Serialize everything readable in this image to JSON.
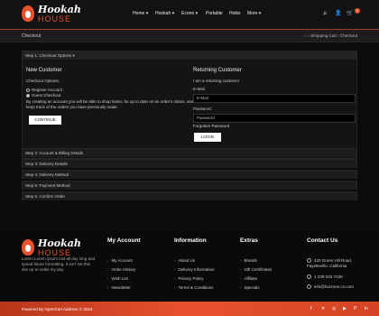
{
  "brand": {
    "line1": "Hookah",
    "line2": "HOUSE"
  },
  "nav": [
    {
      "label": "Home ▾"
    },
    {
      "label": "Hookah ▾"
    },
    {
      "label": "Econo ▾"
    },
    {
      "label": "Portable"
    },
    {
      "label": "Hoiks"
    },
    {
      "label": "More ▾"
    }
  ],
  "header_icons": {
    "search": "⌕",
    "user": "👤",
    "cart": "🛒",
    "cart_count": "0"
  },
  "breadcrumb": {
    "title": "Checkout",
    "home": "⌂",
    "trail": "› Shopping Cart › Checkout"
  },
  "steps": {
    "step1": "Step 1: Checkout Options ▾",
    "step2": "Step 2: Account & Billing Details",
    "step3": "Step 3: Delivery Details",
    "step4": "Step 4: Delivery Method",
    "step5": "Step 5: Payment Method",
    "step6": "Step 6: Confirm Order"
  },
  "new_customer": {
    "heading": "New Customer",
    "options_label": "Checkout Options:",
    "register": "Register Account",
    "guest": "Guest Checkout",
    "info": "By creating an account you will be able to shop faster, be up to date on an order's status, and keep track of the orders you have previously made.",
    "continue": "CONTINUE"
  },
  "returning_customer": {
    "heading": "Returning Customer",
    "sub": "I am a returning customer",
    "email_label": "E-Mail",
    "email_placeholder": "E-Mail",
    "password_label": "Password",
    "password_placeholder": "Password",
    "forgot": "Forgotten Password",
    "login": "LOGIN"
  },
  "footer": {
    "about": "Lorem Lorem ipsum lost all day long and speed future formatting. It isn't set this site up to make my day.",
    "my_account": {
      "heading": "My Account",
      "items": [
        "My Account",
        "Order History",
        "Wish List",
        "Newsletter"
      ]
    },
    "information": {
      "heading": "Information",
      "items": [
        "About Us",
        "Delivery Information",
        "Privacy Policy",
        "Terms & Conditions"
      ]
    },
    "extras": {
      "heading": "Extras",
      "items": [
        "Brands",
        "Gift Certificates",
        "Affiliate",
        "Specials"
      ]
    },
    "contact": {
      "heading": "Contact Us",
      "address": "420 Green Hill Road, Fayetteville, California",
      "phone": "1 239-233-7438",
      "email": "info@hurzone.co.com"
    },
    "powered": "Powered By OpenCart Address © 2024",
    "social": [
      "f",
      "✕",
      "◎",
      "▶",
      "P",
      "in"
    ]
  },
  "colors": {
    "accent": "#e8512d",
    "bg": "#0b0b0b"
  }
}
